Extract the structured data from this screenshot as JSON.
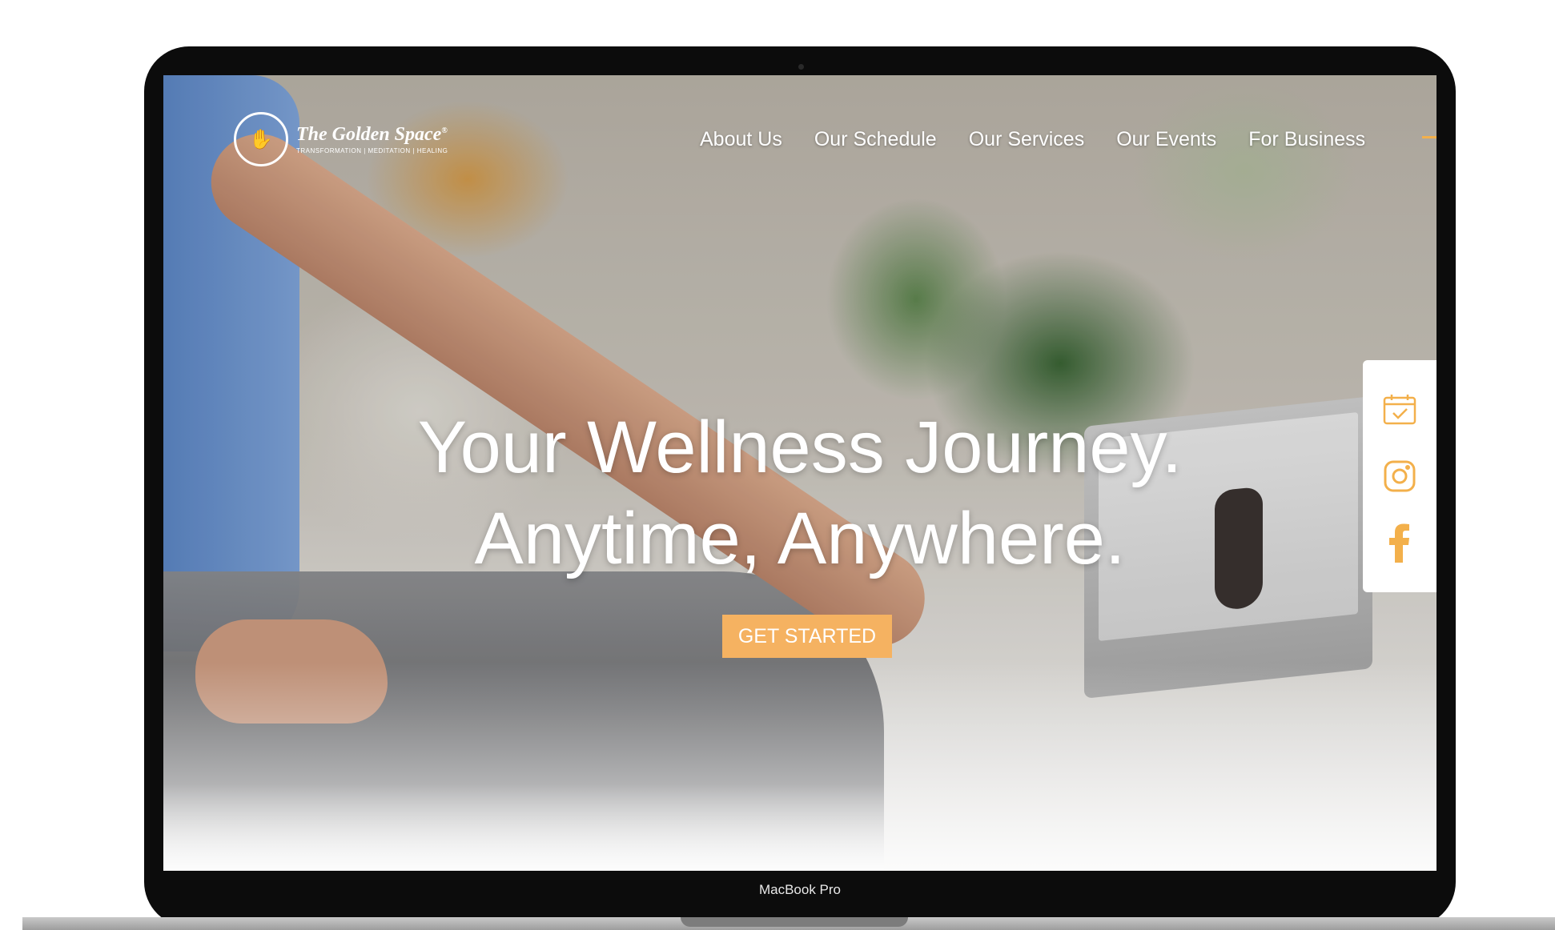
{
  "brand": {
    "name": "The Golden Space",
    "registered": "®",
    "tagline": "TRANSFORMATION | MEDITATION | HEALING"
  },
  "nav": {
    "items": [
      {
        "label": "About Us"
      },
      {
        "label": "Our Schedule"
      },
      {
        "label": "Our Services"
      },
      {
        "label": "Our Events"
      },
      {
        "label": "For Business"
      }
    ]
  },
  "hero": {
    "line1": "Your Wellness Journey.",
    "line2": "Anytime, Anywhere.",
    "cta_label": "GET STARTED"
  },
  "side_panel": {
    "icons": [
      "calendar-check-icon",
      "instagram-icon",
      "facebook-icon"
    ]
  },
  "device": {
    "label": "MacBook Pro"
  },
  "colors": {
    "accent": "#f3b04b",
    "cta": "#f5b261"
  }
}
